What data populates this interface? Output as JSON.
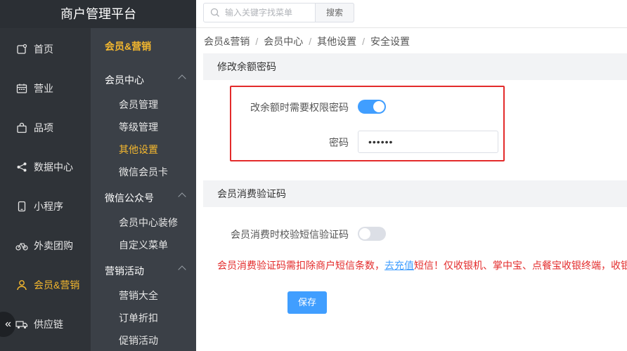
{
  "app": {
    "title": "商户管理平台"
  },
  "nav": [
    {
      "label": "首页",
      "icon": "home-icon",
      "active": false
    },
    {
      "label": "营业",
      "icon": "calendar-icon",
      "active": false
    },
    {
      "label": "品项",
      "icon": "bag-icon",
      "active": false
    },
    {
      "label": "数据中心",
      "icon": "share-icon",
      "active": false
    },
    {
      "label": "小程序",
      "icon": "phone-icon",
      "active": false
    },
    {
      "label": "外卖团购",
      "icon": "bike-icon",
      "active": false
    },
    {
      "label": "会员&营销",
      "icon": "user-icon",
      "active": true
    },
    {
      "label": "供应链",
      "icon": "truck-icon",
      "active": false
    }
  ],
  "collapse_glyph": "«",
  "subnav": {
    "title": "会员&营销",
    "groups": [
      {
        "label": "会员中心",
        "items": [
          "会员管理",
          "等级管理",
          "其他设置",
          "微信会员卡"
        ]
      },
      {
        "label": "微信公众号",
        "items": [
          "会员中心装修",
          "自定义菜单"
        ]
      },
      {
        "label": "营销活动",
        "items": [
          "营销大全",
          "订单折扣",
          "促销活动"
        ]
      }
    ],
    "active_item": "其他设置"
  },
  "search": {
    "placeholder": "输入关键字找菜单",
    "button": "搜索"
  },
  "breadcrumb": [
    "会员&营销",
    "会员中心",
    "其他设置",
    "安全设置"
  ],
  "section1": {
    "title": "修改余额密码",
    "toggle_label": "改余额时需要权限密码",
    "toggle_on": true,
    "password_label": "密码",
    "password_value": "••••••"
  },
  "section2": {
    "title": "会员消费验证码",
    "toggle_label": "会员消费时校验短信验证码",
    "toggle_on": false,
    "warning_before": "会员消费验证码需扣除商户短信条数，",
    "warning_link": "去充值",
    "warning_after": "短信！仅收银机、掌中宝、点餐宝收银终端，收银"
  },
  "save_label": "保存",
  "colors": {
    "accent": "#409eff",
    "active": "#f5b82e",
    "danger": "#e32b2b",
    "sidebar": "#2f3338"
  }
}
